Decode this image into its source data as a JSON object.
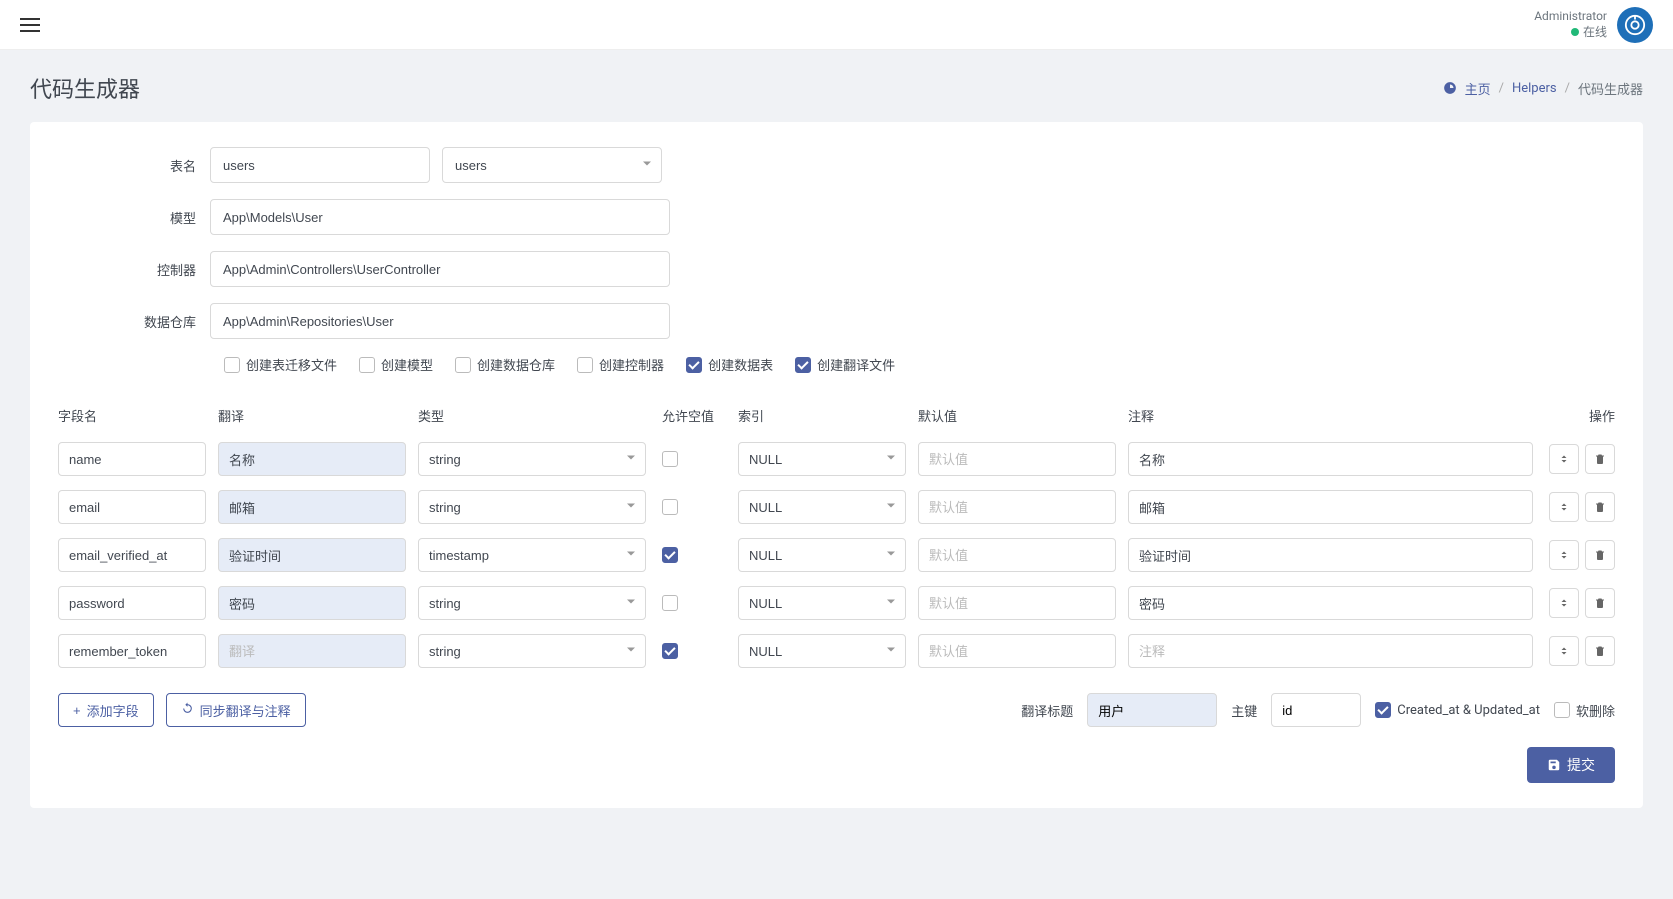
{
  "header": {
    "user_name": "Administrator",
    "status": "在线"
  },
  "page": {
    "title": "代码生成器"
  },
  "breadcrumb": {
    "home": "主页",
    "helpers": "Helpers",
    "current": "代码生成器"
  },
  "form": {
    "table_label": "表名",
    "table_value": "users",
    "table_select": "users",
    "model_label": "模型",
    "model_value": "App\\Models\\User",
    "controller_label": "控制器",
    "controller_value": "App\\Admin\\Controllers\\UserController",
    "repo_label": "数据仓库",
    "repo_value": "App\\Admin\\Repositories\\User"
  },
  "options": {
    "migration": {
      "label": "创建表迁移文件",
      "checked": false
    },
    "model": {
      "label": "创建模型",
      "checked": false
    },
    "repository": {
      "label": "创建数据仓库",
      "checked": false
    },
    "controller": {
      "label": "创建控制器",
      "checked": false
    },
    "table": {
      "label": "创建数据表",
      "checked": true
    },
    "lang": {
      "label": "创建翻译文件",
      "checked": true
    }
  },
  "columns": {
    "field_name": "字段名",
    "translation": "翻译",
    "type": "类型",
    "nullable": "允许空值",
    "index": "索引",
    "default": "默认值",
    "comment": "注释",
    "action": "操作"
  },
  "placeholders": {
    "default": "默认值",
    "translation": "翻译",
    "comment": "注释"
  },
  "fields": [
    {
      "name": "name",
      "translation": "名称",
      "type": "string",
      "nullable": false,
      "index": "NULL",
      "default": "",
      "comment": "名称"
    },
    {
      "name": "email",
      "translation": "邮箱",
      "type": "string",
      "nullable": false,
      "index": "NULL",
      "default": "",
      "comment": "邮箱"
    },
    {
      "name": "email_verified_at",
      "translation": "验证时间",
      "type": "timestamp",
      "nullable": true,
      "index": "NULL",
      "default": "",
      "comment": "验证时间"
    },
    {
      "name": "password",
      "translation": "密码",
      "type": "string",
      "nullable": false,
      "index": "NULL",
      "default": "",
      "comment": "密码"
    },
    {
      "name": "remember_token",
      "translation": "",
      "type": "string",
      "nullable": true,
      "index": "NULL",
      "default": "",
      "comment": ""
    }
  ],
  "footer": {
    "add_field": "添加字段",
    "sync": "同步翻译与注释",
    "trans_title_label": "翻译标题",
    "trans_title_value": "用户",
    "pk_label": "主键",
    "pk_value": "id",
    "timestamps": {
      "label": "Created_at & Updated_at",
      "checked": true
    },
    "soft_delete": {
      "label": "软删除",
      "checked": false
    },
    "submit": "提交"
  }
}
